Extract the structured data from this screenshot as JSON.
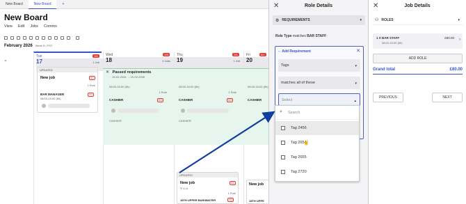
{
  "tabs": [
    "New Board",
    "New Board",
    "+"
  ],
  "board": {
    "title": "New Board",
    "menu": [
      "View",
      "Edit",
      "Jobs",
      "Comms"
    ],
    "month": "February 2026",
    "week": "Week 8 • PST"
  },
  "days": [
    {
      "name": "Tue",
      "date": "17",
      "badge": "0/1",
      "jobs": "1 Job"
    },
    {
      "name": "Wed",
      "date": "18",
      "badge": "0/3",
      "jobs": "3 Jobs"
    },
    {
      "name": "Thu",
      "date": "19",
      "badge": "0/1",
      "jobs": "1 Job"
    },
    {
      "name": "Fri",
      "date": "20",
      "badge": "0/1",
      "jobs": ""
    }
  ],
  "cards": {
    "tue": {
      "hdr": "UPDATED",
      "title": "New job",
      "badge": "0/1",
      "roles": "1 Role",
      "time": "08:00-16:00 (8h)",
      "role": "BAR MANAGER",
      "rbadge": "0/1"
    },
    "passed": {
      "title": "Passed requirements",
      "dates": "19-02-2026 → 20-02-2026"
    },
    "wed": {
      "time": "08:00-16:00 (8h)",
      "roles": "1 Role",
      "role": "CASHIER",
      "rbadge": "0/1",
      "role2": "CASHIER"
    },
    "thu": {
      "time": "08:00-16:00 (8h)",
      "roles": "1 Role",
      "role": "CASHIER",
      "rbadge": "0/1",
      "role2": "CASHIER"
    },
    "fri": {
      "time": "08:00-16:00 (8h)",
      "role": "CASHIER"
    },
    "thu2": {
      "hdr": "UPDATED",
      "title": "New job",
      "badge": "0/1",
      "loc": "LLA",
      "roles": "1 Role",
      "role": "18TH UPPER BAR/WAITER",
      "rbadge": "0/1"
    },
    "fri2": {
      "title": "New job",
      "role": "18TH UPPE"
    }
  },
  "role_panel": {
    "title": "Role Details",
    "section": "REQUIREMENTS",
    "role_type_label": "Role Type",
    "role_type_text": "matches",
    "role_type_value": "BAR STAFF",
    "add_requirement": "Add Requirement",
    "tags_label": "Tags",
    "match_label": "matches all of these",
    "select_placeholder": "Select",
    "search_placeholder": "Search",
    "options": [
      "Tag 2456",
      "Tag 2654",
      "Tag 2655",
      "Tag 2720"
    ]
  },
  "job_panel": {
    "title": "Job Details",
    "section": "ROLES",
    "role_line": "1 X  BAR STAFF",
    "role_time": "08:00-16:00 (8h)",
    "role_price": "£80.00",
    "add_role": "ADD ROLE",
    "grand_total_label": "Grand total",
    "grand_total": "£80.00",
    "previous": "PREVIOUS",
    "next": "NEXT"
  },
  "colors": {
    "accent": "#3555c8",
    "alert": "#e53935",
    "passed_bg": "#e6f5ee",
    "arrow": "#0d3ea0"
  }
}
